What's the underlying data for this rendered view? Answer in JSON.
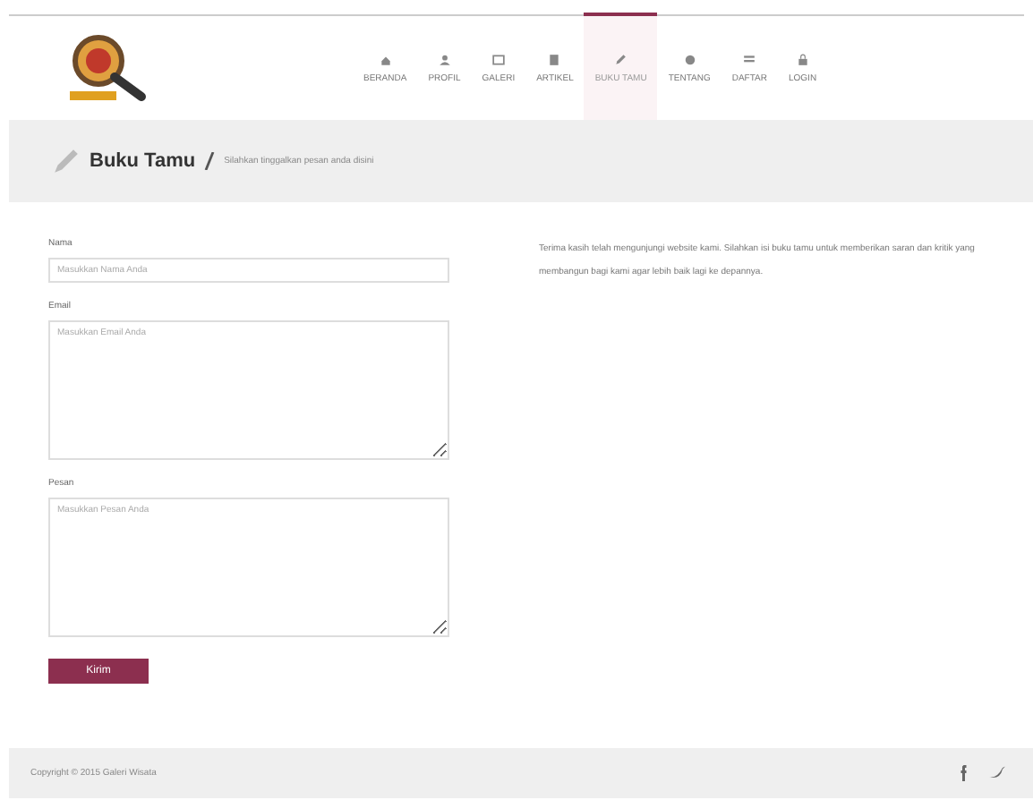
{
  "nav": [
    {
      "label": "BERANDA",
      "selected": false
    },
    {
      "label": "PROFIL",
      "selected": false
    },
    {
      "label": "GALERI",
      "selected": false
    },
    {
      "label": "ARTIKEL",
      "selected": false
    },
    {
      "label": "BUKU TAMU",
      "selected": true
    },
    {
      "label": "TENTANG",
      "selected": false
    },
    {
      "label": "DAFTAR",
      "selected": false
    },
    {
      "label": "LOGIN",
      "selected": false
    }
  ],
  "page_header": {
    "title": "Buku Tamu",
    "subtitle": "Silahkan tinggalkan pesan anda disini"
  },
  "form": {
    "fields": [
      {
        "kind": "input",
        "label": "Nama",
        "placeholder": "Masukkan Nama Anda"
      },
      {
        "kind": "textarea",
        "label": "Email",
        "placeholder": "Masukkan Email Anda"
      },
      {
        "kind": "textarea",
        "label": "Pesan",
        "placeholder": "Masukkan Pesan Anda"
      }
    ],
    "submit": "Kirim"
  },
  "info_text": "Terima kasih telah mengunjungi website kami. Silahkan isi buku tamu untuk memberikan saran dan kritik yang membangun bagi kami agar lebih baik lagi ke depannya.",
  "footer": {
    "copyright": "Copyright © 2015 Galeri Wisata"
  }
}
